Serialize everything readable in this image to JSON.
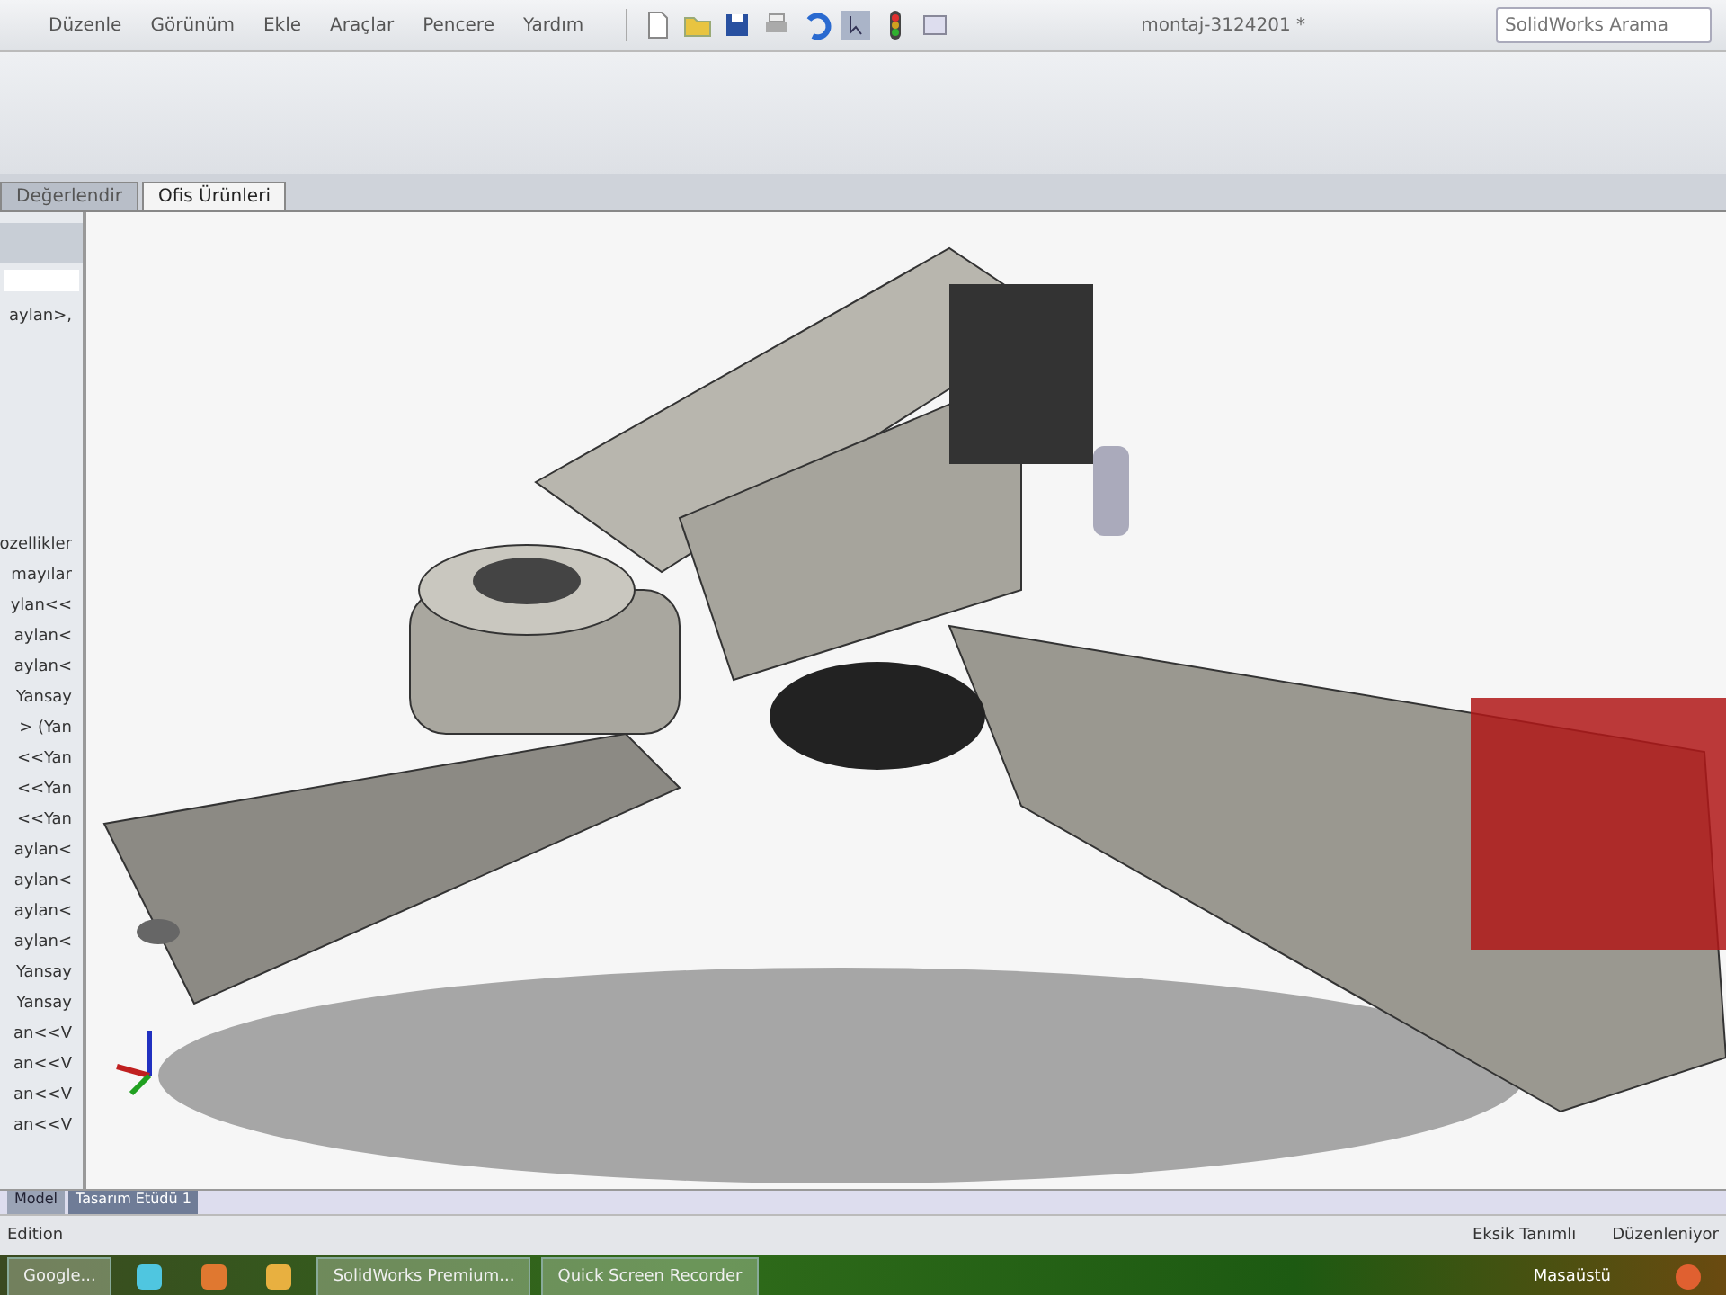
{
  "menu": [
    "Düzenle",
    "Görünüm",
    "Ekle",
    "Araçlar",
    "Pencere",
    "Yardım"
  ],
  "window": {
    "title": "montaj-3124201 *"
  },
  "search": {
    "placeholder": "SolidWorks Arama"
  },
  "tabs": [
    {
      "label": "Değerlendir",
      "selected": false
    },
    {
      "label": "Ofis Ürünleri",
      "selected": true
    }
  ],
  "tree": {
    "items": [
      "aylan>,",
      "ozellikler",
      "mayılar",
      "ylan<<",
      "aylan<",
      "aylan<",
      "Yansay",
      "> (Yan",
      "<<Yan",
      "<<Yan",
      "<<Yan",
      "aylan<",
      "aylan<",
      "aylan<",
      "aylan<",
      "Yansay",
      "Yansay",
      "an<<V",
      "an<<V",
      "an<<V",
      "an<<V"
    ]
  },
  "bottom_tabs": [
    {
      "label": "Model",
      "selected": false
    },
    {
      "label": "Tasarım Etüdü 1",
      "selected": true
    }
  ],
  "status_bar": {
    "left": "Edition",
    "items": [
      "Eksik Tanımlı",
      "Düzenleniyor"
    ]
  },
  "taskbar": {
    "items": [
      {
        "label": "Google...",
        "kind": "window"
      },
      {
        "kind": "quicklaunch"
      },
      {
        "kind": "quicklaunch"
      },
      {
        "kind": "quicklaunch"
      },
      {
        "label": "SolidWorks Premium...",
        "kind": "window"
      },
      {
        "label": "Quick Screen Recorder",
        "kind": "window"
      }
    ],
    "tray": "Masaüstü"
  }
}
